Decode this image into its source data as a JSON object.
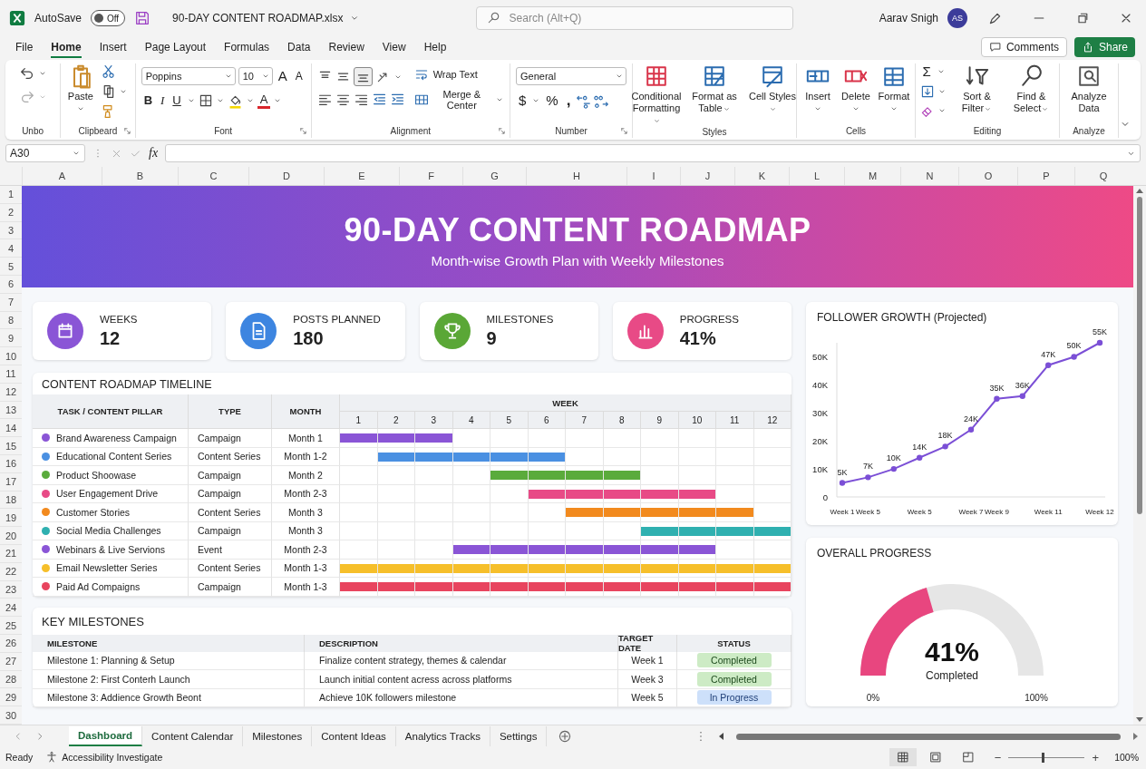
{
  "titlebar": {
    "autosave": {
      "label": "AutoSave",
      "on": false,
      "state": "Off"
    },
    "filename": "90-DAY CONTENT ROADMAP.xlsx",
    "search": {
      "placeholder": "Search (Alt+Q)"
    },
    "user": "Aarav Snigh",
    "avatar": "AS"
  },
  "menu": [
    {
      "label": "File",
      "selected": false
    },
    {
      "label": "Home",
      "selected": true
    },
    {
      "label": "Insert",
      "selected": false
    },
    {
      "label": "Page Layout",
      "selected": false
    },
    {
      "label": "Formulas",
      "selected": false
    },
    {
      "label": "Data",
      "selected": false
    },
    {
      "label": "Review",
      "selected": false
    },
    {
      "label": "View",
      "selected": false
    },
    {
      "label": "Help",
      "selected": false
    }
  ],
  "actions": {
    "comments": "Comments",
    "share": "Share"
  },
  "ribbon": {
    "undo": {
      "label": "Unbo"
    },
    "clipboard": {
      "paste": "Paste",
      "label": "Clipbeard"
    },
    "font": {
      "family": "Poppins",
      "size": "10",
      "grow": "A",
      "shrink": "A",
      "bold": "B",
      "italic": "I",
      "underline": "U",
      "font_color_button": "A",
      "label": "Font"
    },
    "alignment": {
      "wrap": "Wrap Text",
      "merge": "Merge & Center",
      "label": "Alignment"
    },
    "number": {
      "format": "General",
      "currency": "$",
      "percent": "%",
      "comma": ",",
      "label": "Number"
    },
    "styles": {
      "buttons": [
        "Conditional Formatting",
        "Format as Table",
        "Cell Styles"
      ],
      "label": "Styles"
    },
    "cells": {
      "buttons": [
        "Insert",
        "Delete",
        "Format"
      ],
      "label": "Cells"
    },
    "editing": {
      "sum": "Σ",
      "buttons": [
        "Sort & Filter",
        "Find & Select"
      ],
      "label": "Editing"
    },
    "analyze": {
      "button": "Analyze Data",
      "label": "Analyze"
    }
  },
  "formula_bar": {
    "cell": "A30",
    "fx": "fx"
  },
  "columns": [
    "A",
    "B",
    "C",
    "D",
    "E",
    "F",
    "G",
    "H",
    "I",
    "J",
    "K",
    "L",
    "M",
    "N",
    "O",
    "P",
    "Q"
  ],
  "rows": [
    "1",
    "2",
    "3",
    "4",
    "5",
    "6",
    "7",
    "8",
    "9",
    "10",
    "11",
    "12",
    "13",
    "14",
    "15",
    "16",
    "17",
    "18",
    "19",
    "20",
    "21",
    "22",
    "23",
    "24",
    "25",
    "26",
    "27",
    "28",
    "29",
    "30"
  ],
  "banner": {
    "title": "90-DAY CONTENT ROADMAP",
    "subtitle": "Month-wise Growth Plan with Weekly Milestones"
  },
  "kpis": [
    {
      "kind": "calendar",
      "color": "#8a55d6",
      "label": "WEEKS",
      "value": "12"
    },
    {
      "kind": "document",
      "color": "#3d85e0",
      "label": "POSTS PLANNED",
      "value": "180"
    },
    {
      "kind": "trophy",
      "color": "#5aa736",
      "label": "MILESTONES",
      "value": "9"
    },
    {
      "kind": "chart",
      "color": "#e84a86",
      "label": "PROGRESS",
      "value": "41%"
    }
  ],
  "timeline": {
    "title": "CONTENT ROADMAP TIMELINE",
    "columns": [
      "TASK / CONTENT PILLAR",
      "TYPE",
      "MONTH"
    ],
    "week_header": "WEEK",
    "weeks": [
      "1",
      "2",
      "3",
      "4",
      "5",
      "6",
      "7",
      "8",
      "9",
      "10",
      "11",
      "12"
    ],
    "tasks": [
      {
        "name": "Brand Awareness Campaign",
        "type": "Campaign",
        "month": "Month 1",
        "color": "#8a55d6",
        "weeks": [
          true,
          true,
          true,
          false,
          false,
          false,
          false,
          false,
          false,
          false,
          false,
          false
        ]
      },
      {
        "name": "Educational Content Series",
        "type": "Content Series",
        "month": "Month 1-2",
        "color": "#4a90e2",
        "weeks": [
          false,
          true,
          true,
          true,
          true,
          true,
          false,
          false,
          false,
          false,
          false,
          false
        ]
      },
      {
        "name": "Product Shoowase",
        "type": "Campaign",
        "month": "Month 2",
        "color": "#5aab3c",
        "weeks": [
          false,
          false,
          false,
          false,
          true,
          true,
          true,
          true,
          false,
          false,
          false,
          false
        ]
      },
      {
        "name": "User Engagement Drive",
        "type": "Campaign",
        "month": "Month 2-3",
        "color": "#e84a86",
        "weeks": [
          false,
          false,
          false,
          false,
          false,
          true,
          true,
          true,
          true,
          true,
          false,
          false
        ]
      },
      {
        "name": "Customer Stories",
        "type": "Content Series",
        "month": "Month 3",
        "color": "#f28a1e",
        "weeks": [
          false,
          false,
          false,
          false,
          false,
          false,
          true,
          true,
          true,
          true,
          true,
          false
        ]
      },
      {
        "name": "Social Media Challenges",
        "type": "Campaign",
        "month": "Month 3",
        "color": "#2fb0b0",
        "weeks": [
          false,
          false,
          false,
          false,
          false,
          false,
          false,
          false,
          true,
          true,
          true,
          true
        ]
      },
      {
        "name": "Webinars & Live Servions",
        "type": "Event",
        "month": "Month 2-3",
        "color": "#8a55d6",
        "weeks": [
          false,
          false,
          false,
          true,
          true,
          true,
          true,
          true,
          true,
          true,
          false,
          false
        ]
      },
      {
        "name": "Email Newsletter Series",
        "type": "Content Series",
        "month": "Month 1-3",
        "color": "#f6bf2a",
        "weeks": [
          true,
          true,
          true,
          true,
          true,
          true,
          true,
          true,
          true,
          true,
          true,
          true
        ]
      },
      {
        "name": "Paid Ad Compaigns",
        "type": "Campaign",
        "month": "Month 1-3",
        "color": "#e8445e",
        "weeks": [
          true,
          true,
          true,
          true,
          true,
          true,
          true,
          true,
          true,
          true,
          true,
          true
        ]
      }
    ]
  },
  "milestones": {
    "title": "KEY MILESTONES",
    "columns": [
      "MILESTONE",
      "DESCRIPTION",
      "TARGET DATE",
      "STATUS"
    ],
    "rows": [
      {
        "milestone": "Milestone 1: Planning & Setup",
        "description": "Finalize content strategy, themes & calendar",
        "target": "Week 1",
        "status": {
          "label": "Completed",
          "kind": "completed"
        }
      },
      {
        "milestone": "Milestone 2: First Conterh Launch",
        "description": "Launch initial content acress across platforms",
        "target": "Week 3",
        "status": {
          "label": "Completed",
          "kind": "completed"
        }
      },
      {
        "milestone": "Milestone 3: Addience Growth Beont",
        "description": "Achieve 10K followers milestone",
        "target": "Week 5",
        "status": {
          "label": "In Progress",
          "kind": "in_progress"
        }
      }
    ]
  },
  "follower_growth": {
    "chart_data": {
      "type": "line",
      "categories": [
        "Week 1",
        "Week 5",
        null,
        "Week 5",
        null,
        "Week 7",
        "Week 9",
        null,
        "Week 11",
        null,
        "Week 12"
      ],
      "series": [
        {
          "color": "#7b4fd6",
          "marker": "o",
          "values": [
            5000,
            7000,
            10000,
            14000,
            18000,
            24000,
            35000,
            36000,
            47000,
            50000,
            55000
          ]
        }
      ],
      "value_labels": [
        "5K",
        "7K",
        "10K",
        "14K",
        "18K",
        "24K",
        "35K",
        "36K",
        "47K",
        "50K",
        "55K"
      ],
      "ylim": [
        0,
        55000
      ],
      "yticks": [
        {
          "value": 0,
          "label": "0"
        },
        {
          "value": 10000,
          "label": "10K"
        },
        {
          "value": 20000,
          "label": "20K"
        },
        {
          "value": 30000,
          "label": "30K"
        },
        {
          "value": 40000,
          "label": "40K"
        },
        {
          "value": 50000,
          "label": "50K"
        }
      ],
      "title": "FOLLOWER GROWTH (Projected)"
    }
  },
  "overall_progress": {
    "title": "OVERALL PROGRESS",
    "level": 0.41,
    "value": "41%",
    "caption": "Completed",
    "min_label": "0%",
    "max_label": "100%"
  },
  "sheet_tabs": [
    {
      "label": "Dashboard",
      "selected": true
    },
    {
      "label": "Content Calendar",
      "selected": false
    },
    {
      "label": "Milestones",
      "selected": false
    },
    {
      "label": "Content Ideas",
      "selected": false
    },
    {
      "label": "Analytics Tracks",
      "selected": false
    },
    {
      "label": "Settings",
      "selected": false
    }
  ],
  "status_bar": {
    "ready": "Ready",
    "accessibility": "Accessibility Investigate",
    "views": [
      {
        "kind": "normal",
        "selected": true
      },
      {
        "kind": "page_layout",
        "selected": false
      },
      {
        "kind": "page_break",
        "selected": false
      }
    ],
    "zoom": {
      "minus": "−",
      "plus": "+",
      "level": 0.45,
      "value": "100%"
    }
  }
}
